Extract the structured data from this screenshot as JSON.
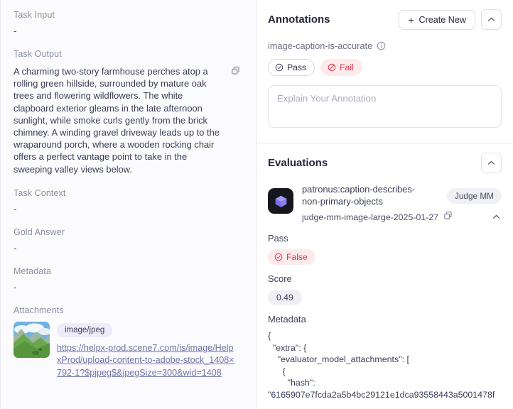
{
  "left": {
    "fields": [
      {
        "label": "Task Input",
        "value": "-"
      },
      {
        "label": "Task Output",
        "value": "A charming two-story farmhouse perches atop a rolling green hillside, surrounded by mature oak trees and flowering wildflowers. The white clapboard exterior gleams in the late afternoon sunlight, while smoke curls gently from the brick chimney. A winding gravel driveway leads up to the wraparound porch, where a wooden rocking chair offers a perfect vantage point to take in the sweeping valley views below."
      },
      {
        "label": "Task Context",
        "value": "-"
      },
      {
        "label": "Gold Answer",
        "value": "-"
      },
      {
        "label": "Metadata",
        "value": "-"
      }
    ],
    "attachments_label": "Attachments",
    "attachment": {
      "mime": "image/jpeg",
      "url": "https://helpx-prod.scene7.com/is/image/HelpxProd/upload-content-to-adobe-stock_1408×792-1?$pjpeg$&jpegSize=300&wid=1408",
      "thumbnail_alt": "green-hillside-landscape-thumbnail"
    },
    "copy_icon": "copy-icon"
  },
  "annotations": {
    "title": "Annotations",
    "create_label": "Create New",
    "plus": "+",
    "collapse_icon": "chevron-up-icon",
    "criteria_name": "image-caption-is-accurate",
    "info_icon": "info-icon",
    "pass_label": "Pass",
    "fail_label": "Fail",
    "explain_placeholder": "Explain Your Annotation",
    "explain_value": ""
  },
  "evaluations": {
    "title": "Evaluations",
    "collapse_icon": "chevron-up-icon",
    "evaluator_name": "patronus:caption-describes-non-primary-objects",
    "model_name": "judge-mm-image-large-2025-01-27",
    "copy_icon": "copy-icon",
    "badge": "Judge MM",
    "avatar_icon": "cube-icon",
    "pass_label": "Pass",
    "pass_value": "False",
    "score_label": "Score",
    "score_value": "0.49",
    "metadata_label": "Metadata",
    "metadata_json": "{\n  \"extra\": {\n    \"evaluator_model_attachments\": [\n      {\n        \"hash\":\n\"6165907e7fcda2a5b4bc29121e1dca93558443a5001478f"
  },
  "colors": {
    "accent_purple": "#7c6cf0",
    "fail_red": "#e0344a",
    "fail_bg": "#fdebec",
    "link": "#6f74a8",
    "muted": "#8b8fa3",
    "panel_bg": "#fbfbfd"
  }
}
